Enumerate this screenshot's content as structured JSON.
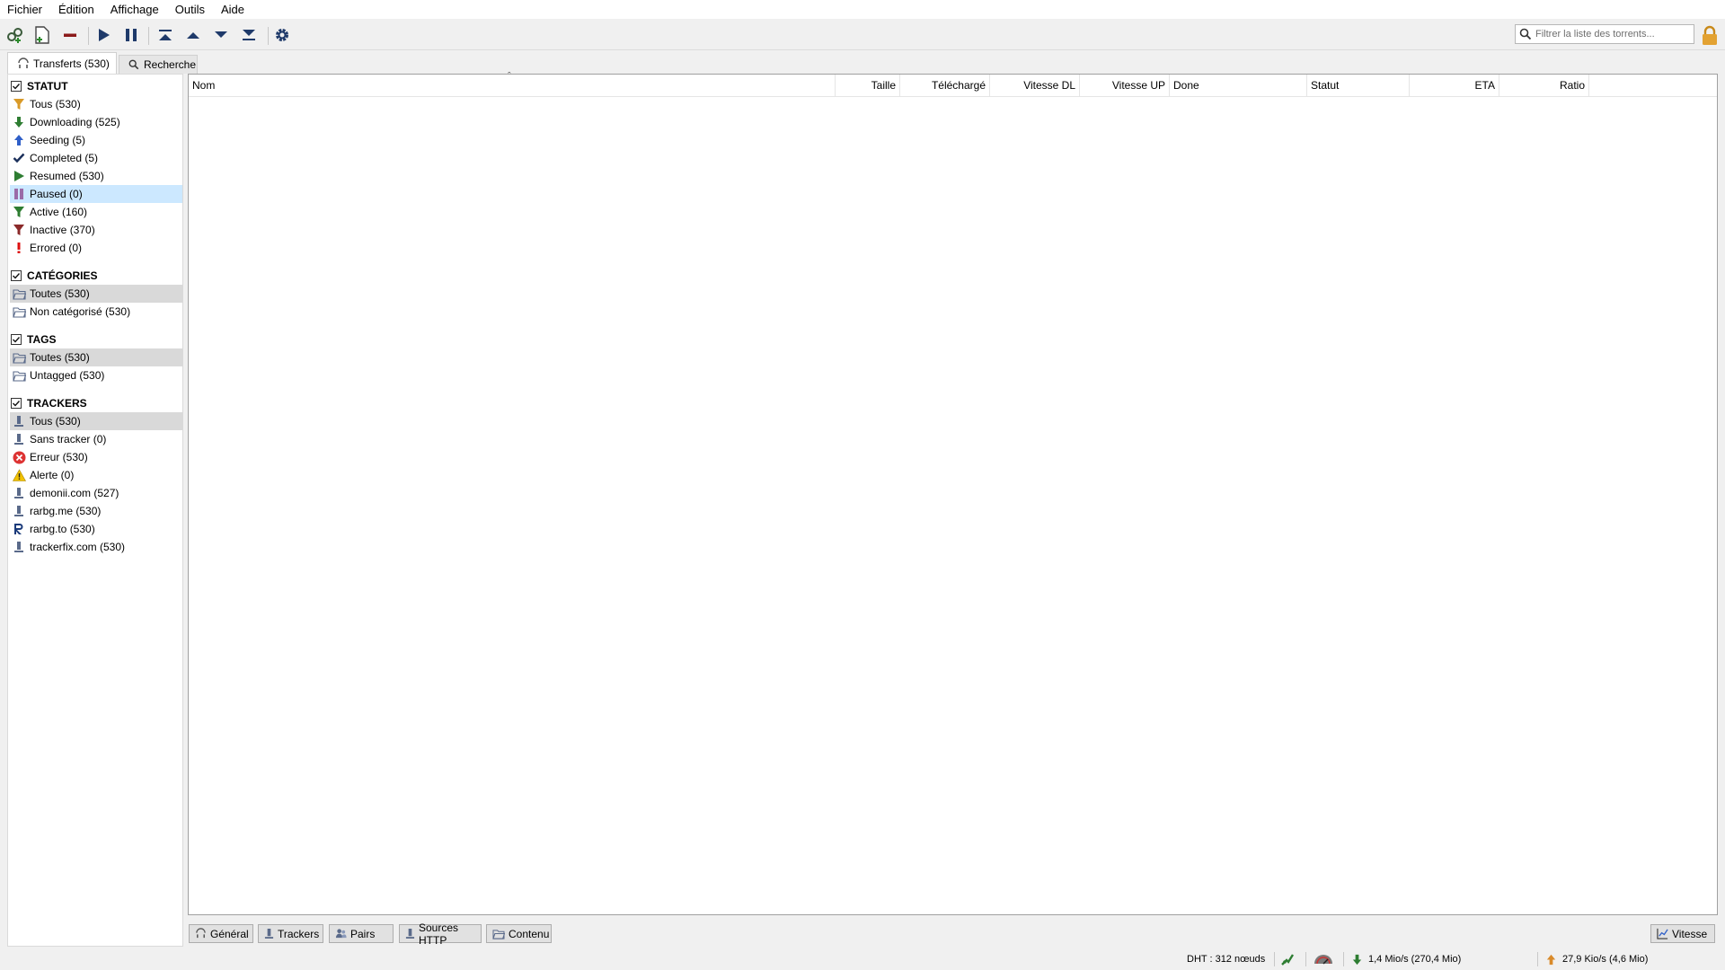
{
  "menu": [
    "Fichier",
    "Édition",
    "Affichage",
    "Outils",
    "Aide"
  ],
  "search": {
    "placeholder": "Filtrer la liste des torrents..."
  },
  "tabs": {
    "transfers": "Transferts (530)",
    "search": "Recherche"
  },
  "sidebar": {
    "status_title": "STATUT",
    "status_items": [
      "Tous (530)",
      "Downloading (525)",
      "Seeding (5)",
      "Completed (5)",
      "Resumed (530)",
      "Paused (0)",
      "Active (160)",
      "Inactive (370)",
      "Errored (0)"
    ],
    "categories_title": "CATÉGORIES",
    "categories_items": [
      "Toutes (530)",
      "Non catégorisé (530)"
    ],
    "tags_title": "TAGS",
    "tags_items": [
      "Toutes (530)",
      "Untagged (530)"
    ],
    "trackers_title": "TRACKERS",
    "trackers_items": [
      "Tous (530)",
      "Sans tracker (0)",
      "Erreur (530)",
      "Alerte (0)",
      "demonii.com (527)",
      "rarbg.me (530)",
      "rarbg.to (530)",
      "trackerfix.com (530)"
    ]
  },
  "table": {
    "columns": [
      "Nom",
      "Taille",
      "Téléchargé",
      "Vitesse DL",
      "Vitesse UP",
      "Done",
      "Statut",
      "ETA",
      "Ratio"
    ]
  },
  "bottom_tabs": [
    "Général",
    "Trackers",
    "Pairs",
    "Sources HTTP",
    "Contenu"
  ],
  "speed_button": "Vitesse",
  "statusbar": {
    "dht": "DHT : 312 nœuds",
    "download": "1,4 Mio/s (270,4 Mio)",
    "upload": "27,9 Kio/s (4,6 Mio)"
  },
  "colors": {
    "selected_blue": "#cce8ff",
    "selected_grey": "#d9d9d9",
    "toolbar_icon": "#1f3a6a"
  }
}
